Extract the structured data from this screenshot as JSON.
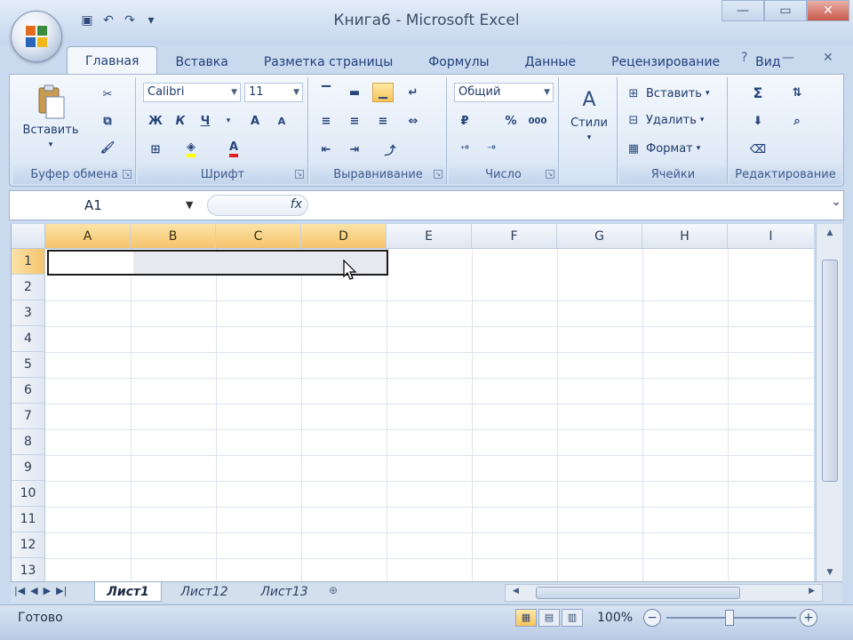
{
  "window": {
    "title_doc": "Книга6",
    "title_sep": " - ",
    "title_app": "Microsoft Excel",
    "controls": [
      "—",
      "▭",
      "✕"
    ]
  },
  "qat": {
    "icons": [
      "save-icon",
      "undo-icon",
      "redo-icon",
      "customize-icon"
    ],
    "glyphs": [
      "▣",
      "↶",
      "↷",
      "▾"
    ]
  },
  "ribbon_tabs": [
    {
      "label": "Главная",
      "active": true
    },
    {
      "label": "Вставка",
      "active": false
    },
    {
      "label": "Разметка страницы",
      "active": false
    },
    {
      "label": "Формулы",
      "active": false
    },
    {
      "label": "Данные",
      "active": false
    },
    {
      "label": "Рецензирование",
      "active": false
    },
    {
      "label": "Вид",
      "active": false
    }
  ],
  "ribbon_right": {
    "help": "?",
    "min": "—",
    "close": "✕"
  },
  "groups": {
    "clipboard": {
      "label": "Буфер обмена",
      "paste": "Вставить"
    },
    "font": {
      "label": "Шрифт",
      "font_name": "Calibri",
      "font_size": "11",
      "bold": "Ж",
      "italic": "К",
      "underline": "Ч",
      "grow": "A",
      "shrink": "A",
      "font_color_letter": "A"
    },
    "alignment": {
      "label": "Выравнивание"
    },
    "number": {
      "label": "Число",
      "format": "Общий",
      "percent": "%",
      "thousands": "000"
    },
    "styles": {
      "label": "Стили",
      "button": "Стили"
    },
    "cells": {
      "label": "Ячейки",
      "insert": "Вставить",
      "delete": "Удалить",
      "format": "Формат"
    },
    "editing": {
      "label": "Редактирование",
      "sum": "Σ"
    }
  },
  "formula_bar": {
    "name_box": "A1",
    "fx": "fx",
    "value": ""
  },
  "columns": [
    "A",
    "B",
    "C",
    "D",
    "E",
    "F",
    "G",
    "H",
    "I"
  ],
  "rows": [
    "1",
    "2",
    "3",
    "4",
    "5",
    "6",
    "7",
    "8",
    "9",
    "10",
    "11",
    "12",
    "13"
  ],
  "sheets": [
    {
      "label": "Лист1",
      "active": true
    },
    {
      "label": "Лист12",
      "active": false
    },
    {
      "label": "Лист13",
      "active": false
    }
  ],
  "status": {
    "ready": "Готово",
    "zoom": "100%"
  }
}
